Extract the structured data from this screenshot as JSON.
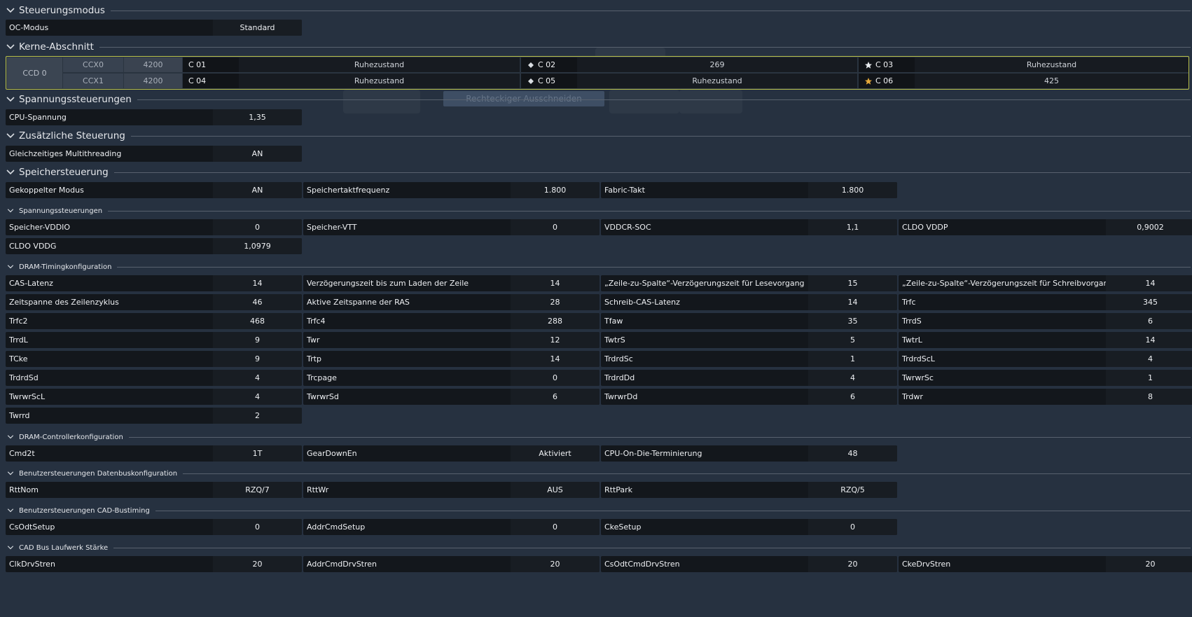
{
  "sections": {
    "steuerungsmodus": "Steuerungsmodus",
    "kerne": "Kerne-Abschnitt",
    "spannung": "Spannungssteuerungen",
    "zusaetzlich": "Zusätzliche Steuerung",
    "speicher": "Speichersteuerung",
    "spannung_mem": "Spannungssteuerungen",
    "dram_timing": "DRAM-Timingkonfiguration",
    "dram_controller": "DRAM-Controllerkonfiguration",
    "datenbus": "Benutzersteuerungen Datenbuskonfiguration",
    "cad_bustiming": "Benutzersteuerungen CAD-Bustiming",
    "cad_drive": "CAD Bus Laufwerk Stärke"
  },
  "background_button": "Rechteckiger Ausschneiden",
  "oc": [
    {
      "label": "OC-Modus",
      "value": "Standard"
    }
  ],
  "cores": {
    "ccd": "CCD 0",
    "ccx": [
      {
        "name": "CCX0",
        "freq": "4200"
      },
      {
        "name": "CCX1",
        "freq": "4200"
      }
    ],
    "items": [
      {
        "label": "C 01",
        "value": "Ruhezustand",
        "icon": "none"
      },
      {
        "label": "C 02",
        "value": "269",
        "icon": "dot-icon"
      },
      {
        "label": "C 03",
        "value": "Ruhezustand",
        "icon": "star-white-icon"
      },
      {
        "label": "C 04",
        "value": "Ruhezustand",
        "icon": "none"
      },
      {
        "label": "C 05",
        "value": "Ruhezustand",
        "icon": "dot-icon"
      },
      {
        "label": "C 06",
        "value": "425",
        "icon": "star-gold-icon"
      }
    ],
    "colors": {
      "border": "#b9c04a",
      "gold": "#e6a93a"
    }
  },
  "spannung": [
    {
      "label": "CPU-Spannung",
      "value": "1,35"
    }
  ],
  "zusaetzlich": [
    {
      "label": "Gleichzeitiges Multithreading",
      "value": "AN"
    }
  ],
  "speicher": [
    {
      "label": "Gekoppelter Modus",
      "value": "AN"
    },
    {
      "label": "Speichertaktfrequenz",
      "value": "1.800"
    },
    {
      "label": "Fabric-Takt",
      "value": "1.800"
    }
  ],
  "spannung_mem": [
    {
      "label": "Speicher-VDDIO",
      "value": "0"
    },
    {
      "label": "Speicher-VTT",
      "value": "0"
    },
    {
      "label": "VDDCR-SOC",
      "value": "1,1"
    },
    {
      "label": "CLDO VDDP",
      "value": "0,9002"
    },
    {
      "label": "CLDO VDDG",
      "value": "1,0979"
    }
  ],
  "dram_timing": [
    {
      "label": "CAS-Latenz",
      "value": "14"
    },
    {
      "label": "Verzögerungszeit bis zum Laden der Zeile",
      "value": "14"
    },
    {
      "label": "„Zeile-zu-Spalte“-Verzögerungszeit für Lesevorgang",
      "value": "15"
    },
    {
      "label": "„Zeile-zu-Spalte“-Verzögerungszeit für Schreibvorgang",
      "value": "14"
    },
    {
      "label": "Zeitspanne des Zeilenzyklus",
      "value": "46"
    },
    {
      "label": "Aktive Zeitspanne der RAS",
      "value": "28"
    },
    {
      "label": "Schreib-CAS-Latenz",
      "value": "14"
    },
    {
      "label": "Trfc",
      "value": "345"
    },
    {
      "label": "Trfc2",
      "value": "468"
    },
    {
      "label": "Trfc4",
      "value": "288"
    },
    {
      "label": "Tfaw",
      "value": "35"
    },
    {
      "label": "TrrdS",
      "value": "6"
    },
    {
      "label": "TrrdL",
      "value": "9"
    },
    {
      "label": "Twr",
      "value": "12"
    },
    {
      "label": "TwtrS",
      "value": "5"
    },
    {
      "label": "TwtrL",
      "value": "14"
    },
    {
      "label": "TCke",
      "value": "9"
    },
    {
      "label": "Trtp",
      "value": "14"
    },
    {
      "label": "TrdrdSc",
      "value": "1"
    },
    {
      "label": "TrdrdScL",
      "value": "4"
    },
    {
      "label": "TrdrdSd",
      "value": "4"
    },
    {
      "label": "Trcpage",
      "value": "0"
    },
    {
      "label": "TrdrdDd",
      "value": "4"
    },
    {
      "label": "TwrwrSc",
      "value": "1"
    },
    {
      "label": "TwrwrScL",
      "value": "4"
    },
    {
      "label": "TwrwrSd",
      "value": "6"
    },
    {
      "label": "TwrwrDd",
      "value": "6"
    },
    {
      "label": "Trdwr",
      "value": "8"
    },
    {
      "label": "Twrrd",
      "value": "2"
    }
  ],
  "dram_controller": [
    {
      "label": "Cmd2t",
      "value": "1T"
    },
    {
      "label": "GearDownEn",
      "value": "Aktiviert"
    },
    {
      "label": "CPU-On-Die-Terminierung",
      "value": "48"
    }
  ],
  "datenbus": [
    {
      "label": "RttNom",
      "value": "RZQ/7"
    },
    {
      "label": "RttWr",
      "value": "AUS"
    },
    {
      "label": "RttPark",
      "value": "RZQ/5"
    }
  ],
  "cad_bustiming": [
    {
      "label": "CsOdtSetup",
      "value": "0"
    },
    {
      "label": "AddrCmdSetup",
      "value": "0"
    },
    {
      "label": "CkeSetup",
      "value": "0"
    }
  ],
  "cad_drive": [
    {
      "label": "ClkDrvStren",
      "value": "20"
    },
    {
      "label": "AddrCmdDrvStren",
      "value": "20"
    },
    {
      "label": "CsOdtCmdDrvStren",
      "value": "20"
    },
    {
      "label": "CkeDrvStren",
      "value": "20"
    }
  ]
}
